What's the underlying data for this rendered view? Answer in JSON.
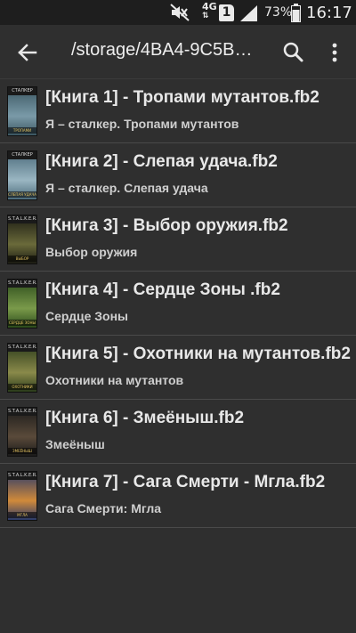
{
  "status_bar": {
    "network": "4G",
    "sim": "1",
    "battery_percent": "73%",
    "time": "16:17",
    "icons": [
      "mute-icon",
      "network-4g-icon",
      "sim-icon",
      "signal-icon",
      "battery-icon"
    ]
  },
  "toolbar": {
    "back_icon": "arrow-left-icon",
    "path": "/storage/4BA4-9C5B…",
    "search_icon": "search-icon",
    "more_icon": "more-vert-icon"
  },
  "files": [
    {
      "name": "[Книга 1] - Тропами мутантов.fb2",
      "subtitle": "Я – сталкер. Тропами мутантов",
      "cover_colors": [
        "#3a5560",
        "#7a9aa8"
      ],
      "cover_header": "СТАЛКЕР",
      "cover_footer": "ТРОПАМИ"
    },
    {
      "name": "[Книга 2] - Слепая удача.fb2",
      "subtitle": "Я – сталкер. Слепая удача",
      "cover_colors": [
        "#4a6a7a",
        "#9ab6c2"
      ],
      "cover_header": "СТАЛКЕР",
      "cover_footer": "СЛЕПАЯ УДАЧА"
    },
    {
      "name": "[Книга 3] - Выбор оружия.fb2",
      "subtitle": "Выбор оружия",
      "cover_colors": [
        "#1a1a12",
        "#6a6a3a"
      ],
      "cover_header": "S.T.A.L.K.E.R.",
      "cover_footer": "ВЫБОР ОРУЖИЯ"
    },
    {
      "name": "[Книга 4] - Сердце Зоны .fb2",
      "subtitle": "Сердце Зоны",
      "cover_colors": [
        "#2a4a1a",
        "#7a9a4a"
      ],
      "cover_header": "S.T.A.L.K.E.R.",
      "cover_footer": "СЕРДЦЕ ЗОНЫ"
    },
    {
      "name": "[Книга 5] - Охотники на мутантов.fb2",
      "subtitle": "Охотники на мутантов",
      "cover_colors": [
        "#2a3a1a",
        "#8a8a4a"
      ],
      "cover_header": "S.T.A.L.K.E.R.",
      "cover_footer": "ОХОТНИКИ"
    },
    {
      "name": "[Книга 6] - Змеёныш.fb2",
      "subtitle": "Змеёныш",
      "cover_colors": [
        "#1a1a1a",
        "#5a4a3a"
      ],
      "cover_header": "S.T.A.L.K.E.R.",
      "cover_footer": "ЗМЕЁНЫШ"
    },
    {
      "name": "[Книга 7] - Сага Смерти - Мгла.fb2",
      "subtitle": "Сага Смерти: Мгла",
      "cover_colors": [
        "#2a3a6a",
        "#d08a3a"
      ],
      "cover_header": "S.T.A.L.K.E.R.",
      "cover_footer": "МГЛА"
    }
  ],
  "colors": {
    "background": "#2f2f2f",
    "status_bar": "#1e1e1e",
    "divider": "#4a4a4a",
    "text_primary": "#e8e8e8",
    "text_secondary": "#cfcfcf"
  }
}
